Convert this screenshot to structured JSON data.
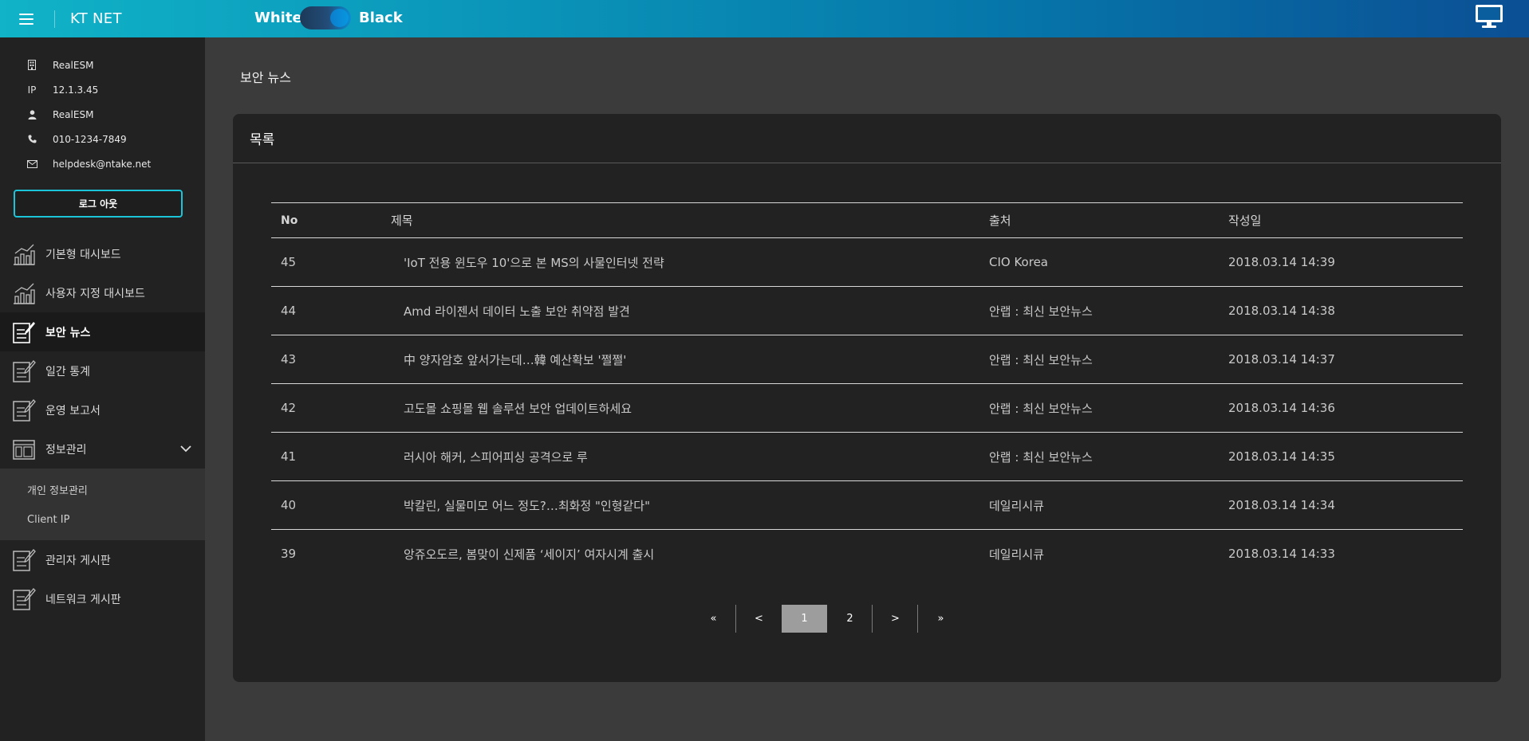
{
  "header": {
    "brand": "KT NET",
    "theme_white": "White",
    "theme_black": "Black",
    "menu_icon": "hamburger-icon",
    "monitor_icon": "monitor-icon"
  },
  "user_info": [
    {
      "icon": "building-icon",
      "label": "",
      "value": "RealESM"
    },
    {
      "icon": "ip-label",
      "label": "IP",
      "value": "12.1.3.45"
    },
    {
      "icon": "user-icon",
      "label": "",
      "value": "RealESM"
    },
    {
      "icon": "phone-icon",
      "label": "",
      "value": "010-1234-7849"
    },
    {
      "icon": "mail-icon",
      "label": "",
      "value": "helpdesk@ntake.net"
    }
  ],
  "logout_label": "로그 아웃",
  "menu": [
    {
      "label": "기본형 대시보드",
      "icon": "chart-icon"
    },
    {
      "label": "사용자 지정 대시보드",
      "icon": "chart-icon"
    },
    {
      "label": "보안 뉴스",
      "icon": "edit-note-icon",
      "active": true
    },
    {
      "label": "일간 통계",
      "icon": "edit-note-icon"
    },
    {
      "label": "운영 보고서",
      "icon": "edit-note-icon"
    },
    {
      "label": "정보관리",
      "icon": "layout-icon",
      "expanded": true
    },
    {
      "label": "관리자 게시판",
      "icon": "edit-note-icon"
    },
    {
      "label": "네트워크 게시판",
      "icon": "edit-note-icon"
    }
  ],
  "submenu": [
    {
      "label": "개인 정보관리"
    },
    {
      "label": "Client IP"
    }
  ],
  "page_title": "보안 뉴스",
  "panel_title": "목록",
  "table": {
    "headers": {
      "no": "No",
      "title": "제목",
      "source": "출처",
      "date": "작성일"
    },
    "rows": [
      {
        "no": "45",
        "title": "'IoT 전용 윈도우 10'으로 본 MS의 사물인터넷 전략",
        "source": "CIO Korea",
        "date": "2018.03.14 14:39"
      },
      {
        "no": "44",
        "title": "Amd 라이젠서 데이터 노출 보안 취약점 발견",
        "source": "안랩 : 최신 보안뉴스",
        "date": "2018.03.14 14:38"
      },
      {
        "no": "43",
        "title": "中 양자암호 앞서가는데…韓 예산확보 '쩔쩔'",
        "source": "안랩 : 최신 보안뉴스",
        "date": "2018.03.14 14:37"
      },
      {
        "no": "42",
        "title": "고도몰 쇼핑몰 웹 솔루션 보안 업데이트하세요",
        "source": "안랩 : 최신 보안뉴스",
        "date": "2018.03.14 14:36"
      },
      {
        "no": "41",
        "title": "러시아 해커, 스피어피싱 공격으로 루",
        "source": "안랩 : 최신 보안뉴스",
        "date": "2018.03.14 14:35"
      },
      {
        "no": "40",
        "title": "박칼린, 실물미모 어느 정도?…최화정 \"인형같다\"",
        "source": "데일리시큐",
        "date": "2018.03.14 14:34"
      },
      {
        "no": "39",
        "title": "앙쥬오도르, 봄맞이 신제품 ‘세이지’ 여자시계 출시",
        "source": "데일리시큐",
        "date": "2018.03.14 14:33"
      }
    ]
  },
  "pagination": {
    "first": "«",
    "prev": "<",
    "pages": [
      "1",
      "2"
    ],
    "current": "1",
    "next": ">",
    "last": "»"
  }
}
